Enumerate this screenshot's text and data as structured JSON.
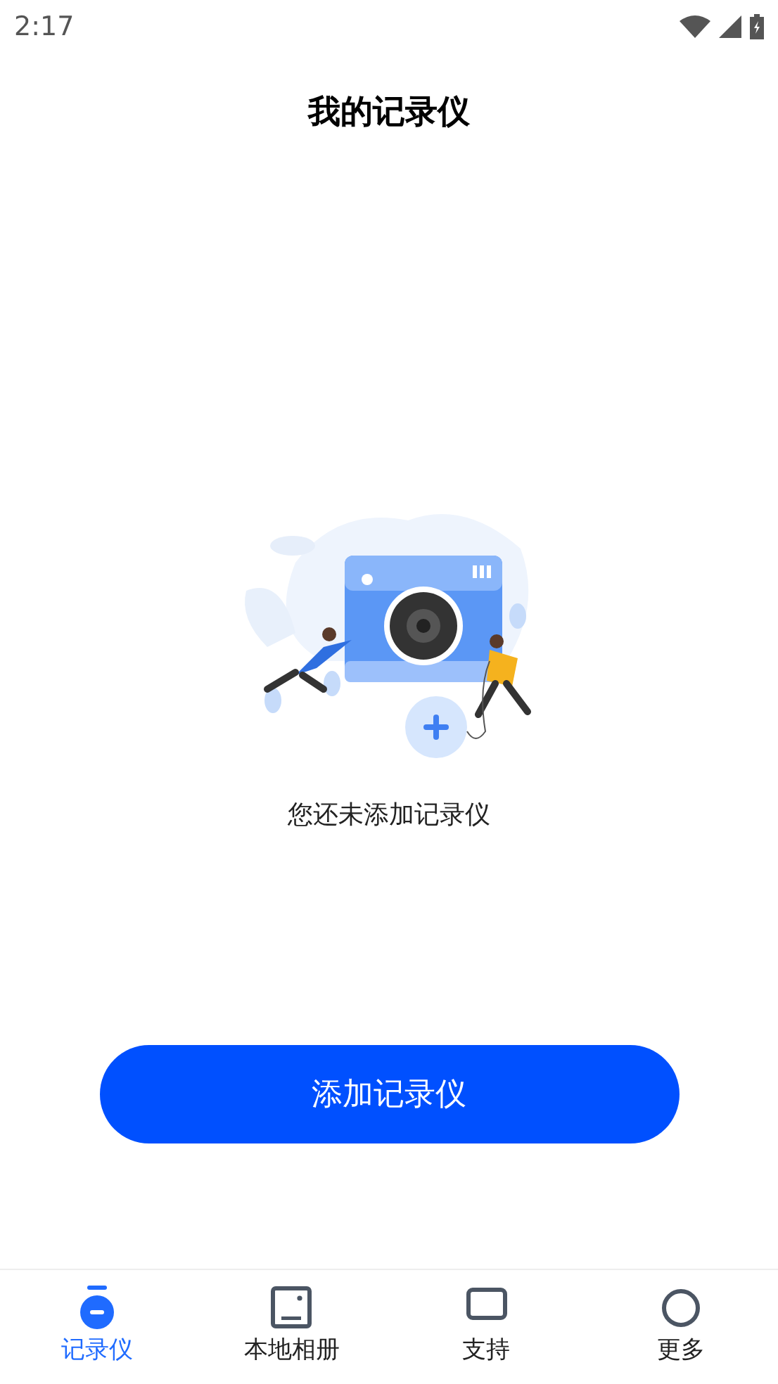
{
  "status_bar": {
    "time": "2:17"
  },
  "header": {
    "title": "我的记录仪"
  },
  "empty_state": {
    "message": "您还未添加记录仪"
  },
  "add_button": {
    "label": "添加记录仪"
  },
  "tabs": [
    {
      "label": "记录仪",
      "kind": "recorder",
      "selected": true
    },
    {
      "label": "本地相册",
      "kind": "album",
      "selected": false
    },
    {
      "label": "支持",
      "kind": "support",
      "selected": false
    },
    {
      "label": "更多",
      "kind": "more",
      "selected": false
    }
  ]
}
